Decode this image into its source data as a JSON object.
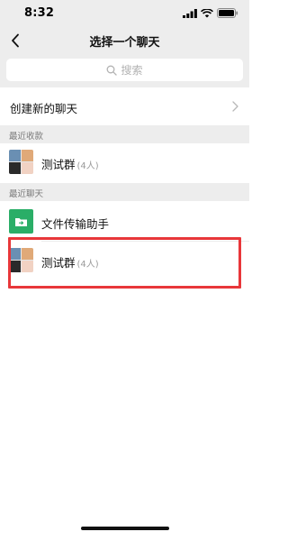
{
  "status_bar": {
    "time": "8:32"
  },
  "nav": {
    "title": "选择一个聊天"
  },
  "search": {
    "placeholder": "搜索"
  },
  "create_chat": {
    "label": "创建新的聊天"
  },
  "sections": {
    "recent_forwards": "最近收款",
    "recent_chats": "最近聊天"
  },
  "recent_forward_items": [
    {
      "name": "测试群",
      "count": "(4人)"
    }
  ],
  "recent_chat_items": [
    {
      "name": "文件传输助手",
      "count": ""
    },
    {
      "name": "测试群",
      "count": "(4人)"
    }
  ],
  "icons": {
    "back": "chevron-left-icon",
    "search": "search-icon",
    "arrow": "chevron-right-icon",
    "file": "folder-icon"
  },
  "colors": {
    "file_helper": "#2aae67",
    "highlight": "#e8373a",
    "background": "#ededed"
  }
}
